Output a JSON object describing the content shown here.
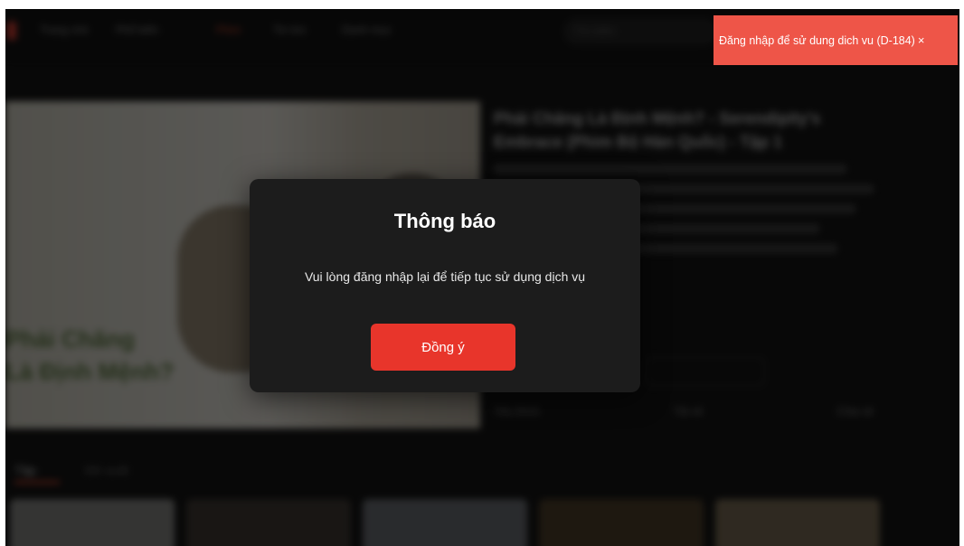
{
  "nav": {
    "items": [
      "Trang chủ",
      "Phổ biến",
      "Phim",
      "Tin tức",
      "Danh mục"
    ],
    "search_placeholder": "Tìm kiếm"
  },
  "hero": {
    "image_text": "Phải Chăng\nLà Định Mệnh?",
    "title": "Phải Chăng Là Định Mệnh? - Serendipity's Embrace (Phim Bộ Hàn Quốc) - Tập 1",
    "actions": [
      "Yêu thích",
      "Tải về",
      "Chia sẻ"
    ]
  },
  "row": {
    "label_active": "Tập",
    "label_inactive": "Đề xuất"
  },
  "modal": {
    "title": "Thông báo",
    "message": "Vui lòng đăng nhập lại để tiếp tục sử dụng dịch vụ",
    "ok_label": "Đồng ý"
  },
  "toast": {
    "text": "Đăng nhập để sử dung dich vu (D-184)",
    "close_symbol": "×",
    "color": "#ee5548"
  },
  "colors": {
    "accent": "#e8352b",
    "modal_bg": "#1c1c1c"
  }
}
